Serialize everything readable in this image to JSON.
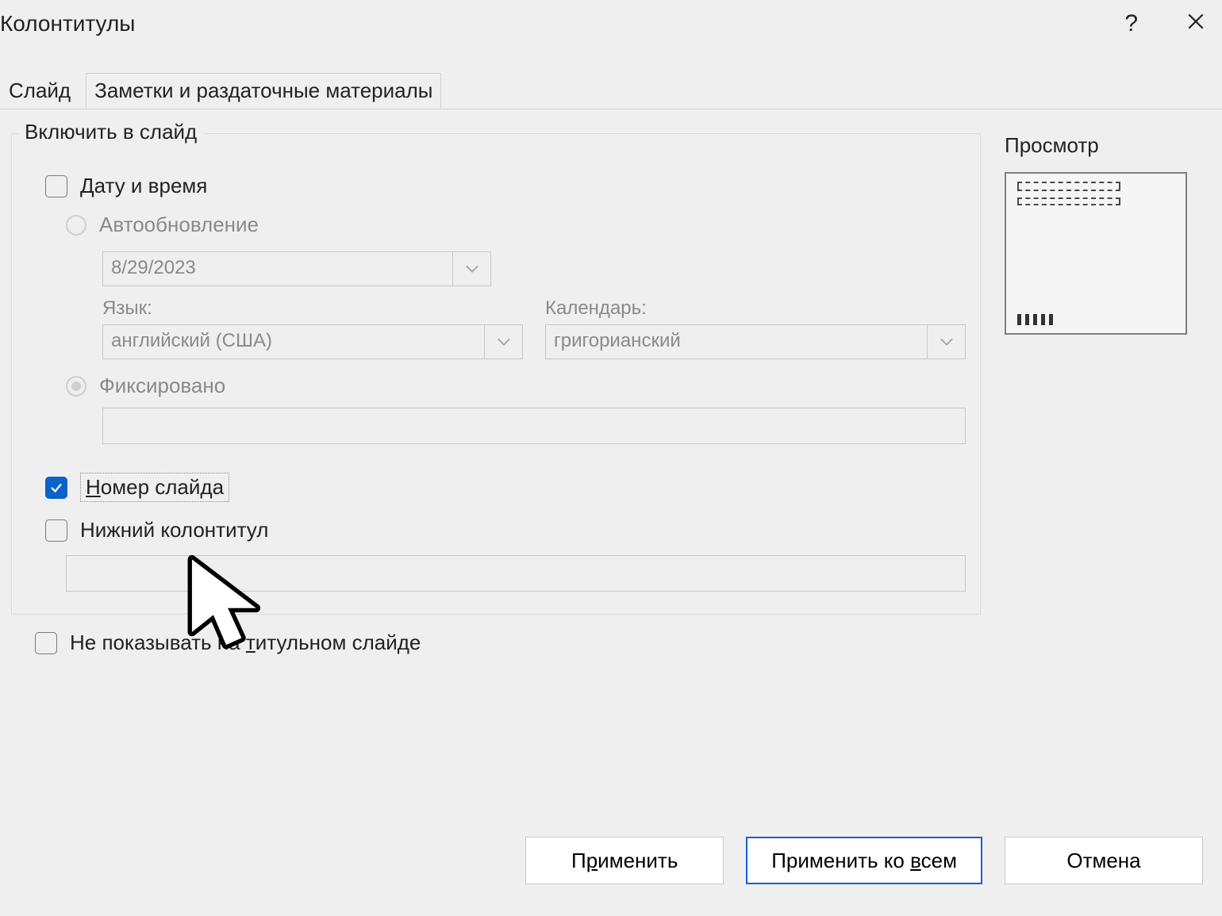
{
  "dialog": {
    "title": "Колонтитулы",
    "help_tooltip": "?",
    "close_tooltip": "Закрыть"
  },
  "tabs": {
    "slide": "Слайд",
    "notes": "Заметки и раздаточные материалы"
  },
  "include_group": {
    "legend": "Включить в слайд",
    "date_time": "Дату и время",
    "auto_update": "Автообновление",
    "date_value": "8/29/2023",
    "language_label": "Язык:",
    "language_value": "английский (США)",
    "calendar_label": "Календарь:",
    "calendar_value": "григорианский",
    "fixed": "Фиксировано",
    "slide_number_prefix": "Н",
    "slide_number_rest": "омер слайда",
    "footer": "Нижний колонтитул"
  },
  "hide_title": {
    "prefix": "Не показывать на ",
    "ul": "т",
    "suffix": "итульном слайде"
  },
  "preview": {
    "label": "Просмотр"
  },
  "buttons": {
    "apply": {
      "prefix": "П",
      "ul": "р",
      "suffix": "именить"
    },
    "apply_all": {
      "prefix": "Применить ко ",
      "ul": "в",
      "suffix": "сем"
    },
    "cancel": "Отмена"
  },
  "colors": {
    "accent": "#0a63c9"
  }
}
